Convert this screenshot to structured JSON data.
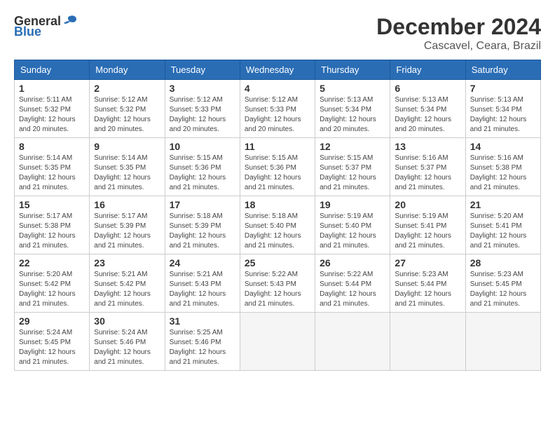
{
  "header": {
    "logo_general": "General",
    "logo_blue": "Blue",
    "title": "December 2024",
    "location": "Cascavel, Ceara, Brazil"
  },
  "calendar": {
    "days_of_week": [
      "Sunday",
      "Monday",
      "Tuesday",
      "Wednesday",
      "Thursday",
      "Friday",
      "Saturday"
    ],
    "weeks": [
      [
        {
          "day": "",
          "empty": true
        },
        {
          "day": "",
          "empty": true
        },
        {
          "day": "",
          "empty": true
        },
        {
          "day": "",
          "empty": true
        },
        {
          "day": "",
          "empty": true
        },
        {
          "day": "",
          "empty": true
        },
        {
          "day": "",
          "empty": true
        }
      ]
    ],
    "cells": [
      {
        "day": 1,
        "sunrise": "5:11 AM",
        "sunset": "5:32 PM",
        "daylight": "12 hours and 20 minutes."
      },
      {
        "day": 2,
        "sunrise": "5:12 AM",
        "sunset": "5:32 PM",
        "daylight": "12 hours and 20 minutes."
      },
      {
        "day": 3,
        "sunrise": "5:12 AM",
        "sunset": "5:33 PM",
        "daylight": "12 hours and 20 minutes."
      },
      {
        "day": 4,
        "sunrise": "5:12 AM",
        "sunset": "5:33 PM",
        "daylight": "12 hours and 20 minutes."
      },
      {
        "day": 5,
        "sunrise": "5:13 AM",
        "sunset": "5:34 PM",
        "daylight": "12 hours and 20 minutes."
      },
      {
        "day": 6,
        "sunrise": "5:13 AM",
        "sunset": "5:34 PM",
        "daylight": "12 hours and 20 minutes."
      },
      {
        "day": 7,
        "sunrise": "5:13 AM",
        "sunset": "5:34 PM",
        "daylight": "12 hours and 21 minutes."
      },
      {
        "day": 8,
        "sunrise": "5:14 AM",
        "sunset": "5:35 PM",
        "daylight": "12 hours and 21 minutes."
      },
      {
        "day": 9,
        "sunrise": "5:14 AM",
        "sunset": "5:35 PM",
        "daylight": "12 hours and 21 minutes."
      },
      {
        "day": 10,
        "sunrise": "5:15 AM",
        "sunset": "5:36 PM",
        "daylight": "12 hours and 21 minutes."
      },
      {
        "day": 11,
        "sunrise": "5:15 AM",
        "sunset": "5:36 PM",
        "daylight": "12 hours and 21 minutes."
      },
      {
        "day": 12,
        "sunrise": "5:15 AM",
        "sunset": "5:37 PM",
        "daylight": "12 hours and 21 minutes."
      },
      {
        "day": 13,
        "sunrise": "5:16 AM",
        "sunset": "5:37 PM",
        "daylight": "12 hours and 21 minutes."
      },
      {
        "day": 14,
        "sunrise": "5:16 AM",
        "sunset": "5:38 PM",
        "daylight": "12 hours and 21 minutes."
      },
      {
        "day": 15,
        "sunrise": "5:17 AM",
        "sunset": "5:38 PM",
        "daylight": "12 hours and 21 minutes."
      },
      {
        "day": 16,
        "sunrise": "5:17 AM",
        "sunset": "5:39 PM",
        "daylight": "12 hours and 21 minutes."
      },
      {
        "day": 17,
        "sunrise": "5:18 AM",
        "sunset": "5:39 PM",
        "daylight": "12 hours and 21 minutes."
      },
      {
        "day": 18,
        "sunrise": "5:18 AM",
        "sunset": "5:40 PM",
        "daylight": "12 hours and 21 minutes."
      },
      {
        "day": 19,
        "sunrise": "5:19 AM",
        "sunset": "5:40 PM",
        "daylight": "12 hours and 21 minutes."
      },
      {
        "day": 20,
        "sunrise": "5:19 AM",
        "sunset": "5:41 PM",
        "daylight": "12 hours and 21 minutes."
      },
      {
        "day": 21,
        "sunrise": "5:20 AM",
        "sunset": "5:41 PM",
        "daylight": "12 hours and 21 minutes."
      },
      {
        "day": 22,
        "sunrise": "5:20 AM",
        "sunset": "5:42 PM",
        "daylight": "12 hours and 21 minutes."
      },
      {
        "day": 23,
        "sunrise": "5:21 AM",
        "sunset": "5:42 PM",
        "daylight": "12 hours and 21 minutes."
      },
      {
        "day": 24,
        "sunrise": "5:21 AM",
        "sunset": "5:43 PM",
        "daylight": "12 hours and 21 minutes."
      },
      {
        "day": 25,
        "sunrise": "5:22 AM",
        "sunset": "5:43 PM",
        "daylight": "12 hours and 21 minutes."
      },
      {
        "day": 26,
        "sunrise": "5:22 AM",
        "sunset": "5:44 PM",
        "daylight": "12 hours and 21 minutes."
      },
      {
        "day": 27,
        "sunrise": "5:23 AM",
        "sunset": "5:44 PM",
        "daylight": "12 hours and 21 minutes."
      },
      {
        "day": 28,
        "sunrise": "5:23 AM",
        "sunset": "5:45 PM",
        "daylight": "12 hours and 21 minutes."
      },
      {
        "day": 29,
        "sunrise": "5:24 AM",
        "sunset": "5:45 PM",
        "daylight": "12 hours and 21 minutes."
      },
      {
        "day": 30,
        "sunrise": "5:24 AM",
        "sunset": "5:46 PM",
        "daylight": "12 hours and 21 minutes."
      },
      {
        "day": 31,
        "sunrise": "5:25 AM",
        "sunset": "5:46 PM",
        "daylight": "12 hours and 21 minutes."
      }
    ]
  }
}
